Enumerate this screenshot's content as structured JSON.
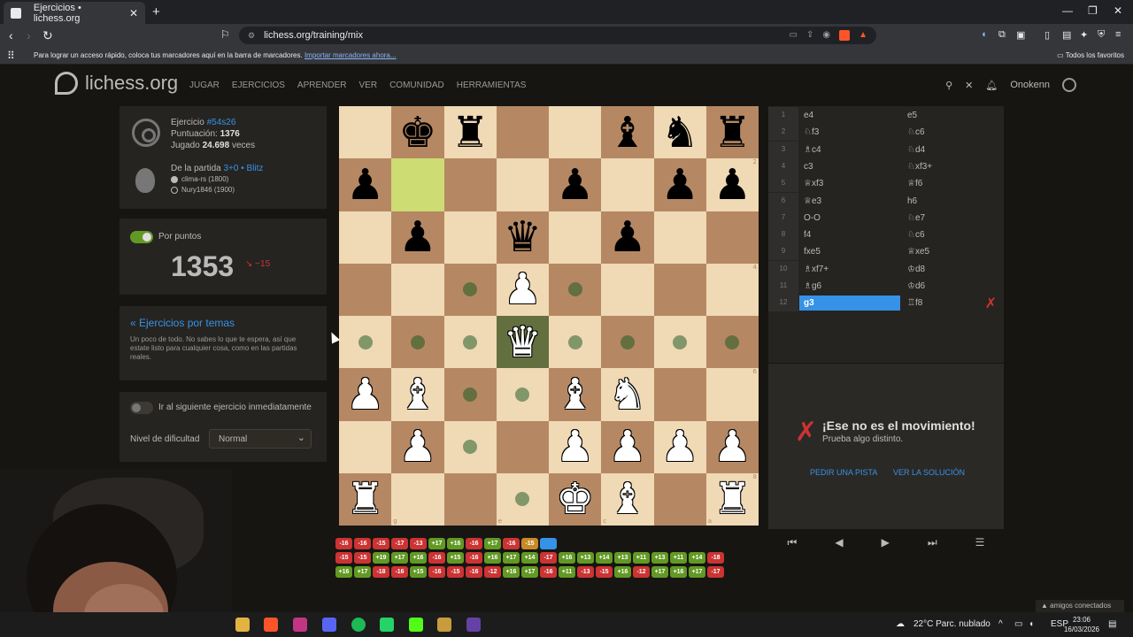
{
  "browser": {
    "tab_title": "Ejercicios • lichess.org",
    "url": "lichess.org/training/mix",
    "bookmarks_msg": "Para lograr un acceso rápido, coloca tus marcadores aquí en la barra de marcadores.",
    "bookmarks_link": "Importar marcadores ahora...",
    "all_favorites": "Todos los favoritos"
  },
  "site": {
    "logo": "lichess.org",
    "nav": [
      "JUGAR",
      "EJERCICIOS",
      "APRENDER",
      "VER",
      "COMUNIDAD",
      "HERRAMIENTAS"
    ],
    "username": "Onokenn"
  },
  "puzzle": {
    "label": "Ejercicio",
    "id": "#54s26",
    "rating_label": "Puntuación:",
    "rating": "1376",
    "played_label": "Jugado",
    "played": "24.698",
    "played_suffix": "veces",
    "from_game": "De la partida",
    "game_type": "3+0 • Blitz",
    "white_player": "clima-rs (1800)",
    "black_player": "Nury1846 (1900)"
  },
  "scoring": {
    "label": "Por puntos",
    "rating": "1353",
    "delta": "−15"
  },
  "themes": {
    "link": "« Ejercicios por temas",
    "desc": "Un poco de todo. No sabes lo que te espera, así que estate listo para cualquier cosa, como en las partidas reales."
  },
  "settings": {
    "next_label": "Ir al siguiente ejercicio inmediatamente",
    "difficulty_label": "Nivel de dificultad",
    "difficulty_value": "Normal"
  },
  "board": {
    "ranks": [
      [
        "",
        "bK",
        "bR",
        "",
        "",
        "bB",
        "bN",
        "bR"
      ],
      [
        "bP",
        "",
        "",
        "",
        "bP",
        "",
        "bP",
        "bP"
      ],
      [
        "",
        "bP",
        "",
        "bQ",
        "",
        "bP",
        "",
        ""
      ],
      [
        "",
        "",
        "",
        "wP",
        "",
        "",
        "",
        ""
      ],
      [
        "",
        "",
        "",
        "wQ",
        "",
        "",
        "",
        ""
      ],
      [
        "wP",
        "wB",
        "",
        "",
        "wB",
        "wN",
        "",
        ""
      ],
      [
        "",
        "wP",
        "",
        "",
        "wP",
        "wP",
        "wP",
        "wP"
      ],
      [
        "wR",
        "",
        "",
        "",
        "wK",
        "wB",
        "",
        "wR"
      ]
    ],
    "rank_labels": [
      "1",
      "2",
      "3",
      "4",
      "5",
      "6",
      "7",
      "8"
    ],
    "file_labels": [
      "h",
      "g",
      "f",
      "e",
      "d",
      "c",
      "b",
      "a"
    ]
  },
  "moves": [
    {
      "n": "1",
      "w": "e4",
      "b": "e5"
    },
    {
      "n": "2",
      "w": "♘f3",
      "b": "♘c6"
    },
    {
      "n": "3",
      "w": "♗c4",
      "b": "♘d4"
    },
    {
      "n": "4",
      "w": "c3",
      "b": "♘xf3+"
    },
    {
      "n": "5",
      "w": "♕xf3",
      "b": "♕f6"
    },
    {
      "n": "6",
      "w": "♕e3",
      "b": "h6"
    },
    {
      "n": "7",
      "w": "O-O",
      "b": "♘e7"
    },
    {
      "n": "8",
      "w": "f4",
      "b": "♘c6"
    },
    {
      "n": "9",
      "w": "fxe5",
      "b": "♕xe5"
    },
    {
      "n": "10",
      "w": "♗xf7+",
      "b": "♔d8"
    },
    {
      "n": "11",
      "w": "♗g6",
      "b": "♔d6"
    },
    {
      "n": "12",
      "w": "g3",
      "b": "♖f8"
    }
  ],
  "feedback": {
    "title": "¡Ese no es el movimiento!",
    "subtitle": "Prueba algo distinto.",
    "hint": "PEDIR UNA PISTA",
    "solution": "VER LA SOLUCIÓN"
  },
  "history": [
    [
      "-16",
      "-16",
      "-15",
      "-17",
      "-13",
      "+17",
      "+16",
      "-16",
      "+17",
      "-16",
      "-15",
      ""
    ],
    [
      "-15",
      "-15",
      "+19",
      "+17",
      "+16",
      "-16",
      "+15",
      "-16",
      "+16",
      "+17",
      "+14",
      "-17",
      "+16",
      "+13",
      "+14",
      "+13",
      "+11",
      "+13",
      "+11",
      "+14",
      "-18"
    ],
    [
      "+16",
      "+17",
      "-18",
      "-16",
      "+15",
      "-16",
      "-15",
      "-16",
      "-12",
      "+16",
      "+17",
      "-16",
      "+11",
      "-13",
      "-15",
      "+16",
      "-12",
      "+17",
      "+16",
      "+17",
      "-17"
    ]
  ],
  "taskbar": {
    "weather": "22°C  Parc. nublado",
    "lang": "ESP",
    "time": "23:06",
    "date": "16/03/2026",
    "friends": "▲ amigos conectados"
  },
  "colors": {
    "accent": "#3692e7",
    "good": "#629924",
    "bad": "#cc3333"
  }
}
